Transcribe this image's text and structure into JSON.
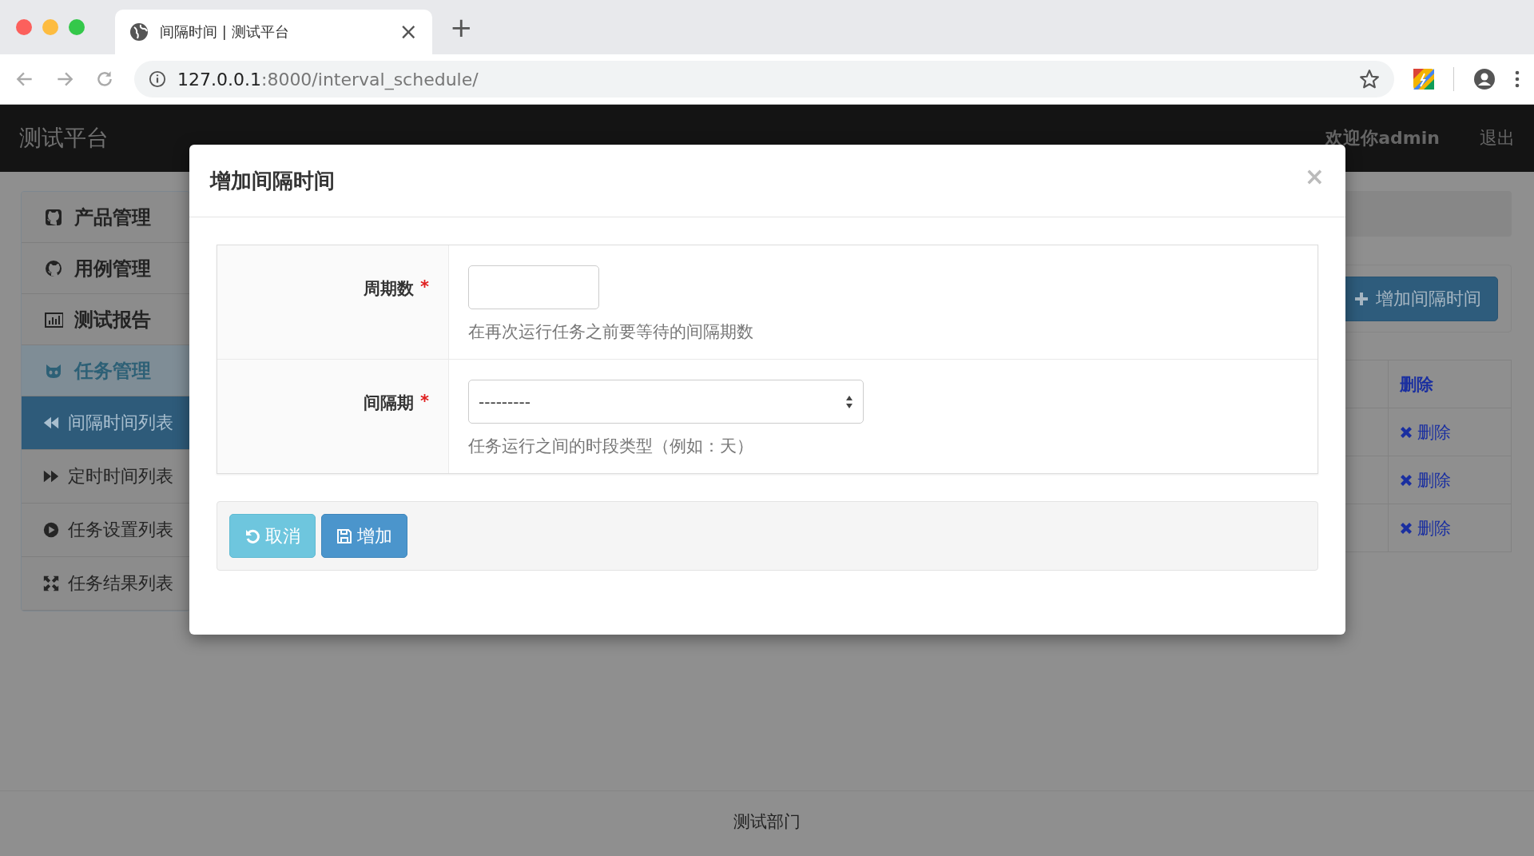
{
  "browser": {
    "tab_title": "间隔时间 | 测试平台",
    "close": "×",
    "new_tab": "+",
    "url_host": "127.0.0.1",
    "url_rest": ":8000/interval_schedule/"
  },
  "navbar": {
    "brand": "测试平台",
    "links": [
      "欢迎你admin",
      "退出"
    ]
  },
  "sidebar": {
    "items": [
      {
        "label": "产品管理",
        "expanded": false
      },
      {
        "label": "用例管理",
        "expanded": false
      },
      {
        "label": "测试报告",
        "expanded": false
      },
      {
        "label": "任务管理",
        "expanded": true,
        "children": [
          {
            "label": "间隔时间列表",
            "selected": true
          },
          {
            "label": "定时时间列表",
            "selected": false
          },
          {
            "label": "任务设置列表",
            "selected": false
          },
          {
            "label": "任务结果列表",
            "selected": false
          }
        ]
      }
    ]
  },
  "content": {
    "add_button": "增加间隔时间",
    "table": {
      "columns": [
        "删除"
      ],
      "rows": [
        {
          "action": "删除"
        },
        {
          "action": "删除"
        },
        {
          "action": "删除"
        }
      ]
    }
  },
  "footer": "测试部门",
  "modal": {
    "title": "增加间隔时间",
    "close": "×",
    "fields": [
      {
        "label": "周期数",
        "required_mark": "*",
        "kind": "input",
        "help": "在再次运行任务之前要等待的间隔期数"
      },
      {
        "label": "间隔期",
        "required_mark": "*",
        "kind": "select",
        "value": "---------",
        "help": "任务运行之间的时段类型（例如：天）"
      }
    ],
    "buttons": [
      {
        "label": "取消",
        "kind": "cancel"
      },
      {
        "label": "增加",
        "kind": "submit"
      }
    ]
  }
}
